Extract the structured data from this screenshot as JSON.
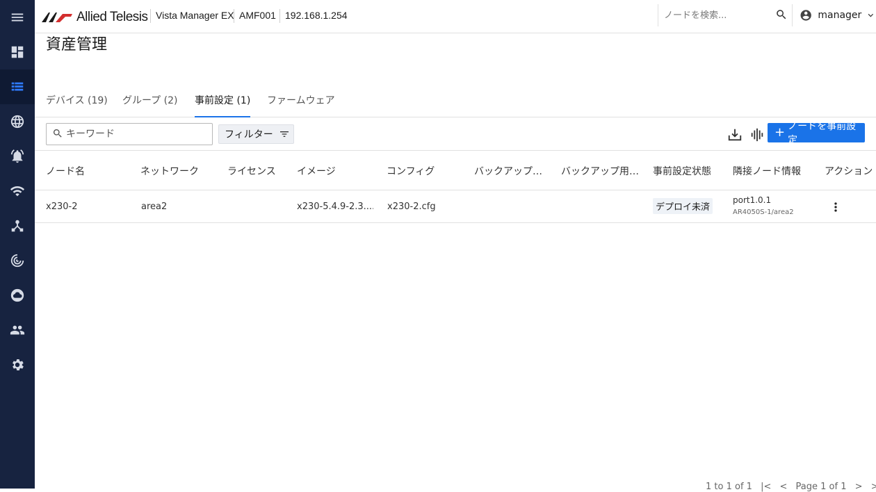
{
  "header": {
    "logo_text": "Allied Telesis",
    "product": "Vista Manager EX",
    "area": "AMF001",
    "ip": "192.168.1.254",
    "search_placeholder": "ノードを検索...",
    "user": "manager"
  },
  "page": {
    "title": "資産管理"
  },
  "tabs": [
    {
      "label": "デバイス (19)"
    },
    {
      "label": "グループ (2)"
    },
    {
      "label": "事前設定 (1)"
    },
    {
      "label": "ファームウェア"
    }
  ],
  "toolbar": {
    "keyword_placeholder": "キーワード",
    "filter_label": "フィルター",
    "add_label": "ノードを事前設定"
  },
  "table": {
    "headers": [
      "ノード名",
      "ネットワーク",
      "ライセンス",
      "イメージ",
      "コンフィグ",
      "バックアップ用イメージ",
      "バックアップ用コンフィグ",
      "事前設定状態",
      "隣接ノード情報",
      "アクション"
    ],
    "rows": [
      {
        "node": "x230-2",
        "network": "area2",
        "license": "",
        "image": "x230-5.4.9-2.3....",
        "config": "x230-2.cfg",
        "backup_image": "",
        "backup_config": "",
        "status": "デプロイ未済",
        "neighbor_port": "port1.0.1",
        "neighbor_node": "AR4050S-1/area2"
      }
    ]
  },
  "pager": {
    "range": "1 to 1 of 1",
    "page": "Page 1 of 1"
  },
  "colors": {
    "sidebar": "#172340",
    "accent": "#1a73e8"
  }
}
